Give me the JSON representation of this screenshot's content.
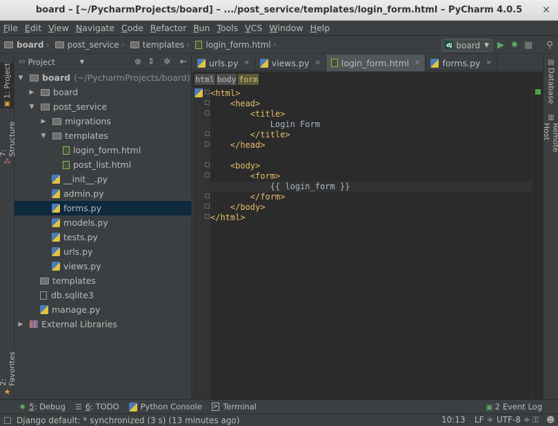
{
  "window": {
    "title": "board – [~/PycharmProjects/board] – .../post_service/templates/login_form.html – PyCharm 4.0.5"
  },
  "menu": [
    "File",
    "Edit",
    "View",
    "Navigate",
    "Code",
    "Refactor",
    "Run",
    "Tools",
    "VCS",
    "Window",
    "Help"
  ],
  "breadcrumbs": [
    "board",
    "post_service",
    "templates",
    "login_form.html"
  ],
  "run_config": {
    "badge": "dj",
    "name": "board"
  },
  "left_strip": {
    "project_tab": "1: Project",
    "structure_tab": "7: Structure",
    "favorites_tab": "2: Favorites"
  },
  "right_strip": {
    "database_tab": "Database",
    "remote_host_tab": "Remote Host"
  },
  "project_panel": {
    "view_label": "Project",
    "root": {
      "name": "board",
      "path": "(~/PycharmProjects/board)"
    },
    "items": [
      {
        "label": "board",
        "type": "folder",
        "expand": "collapsed"
      },
      {
        "label": "post_service",
        "type": "folder",
        "expand": "expanded"
      },
      {
        "label": "migrations",
        "type": "folder",
        "expand": "collapsed"
      },
      {
        "label": "templates",
        "type": "folder",
        "expand": "expanded"
      },
      {
        "label": "login_form.html",
        "type": "html"
      },
      {
        "label": "post_list.html",
        "type": "html"
      },
      {
        "label": "__init__.py",
        "type": "py"
      },
      {
        "label": "admin.py",
        "type": "py"
      },
      {
        "label": "forms.py",
        "type": "py",
        "selected": true
      },
      {
        "label": "models.py",
        "type": "py"
      },
      {
        "label": "tests.py",
        "type": "py"
      },
      {
        "label": "urls.py",
        "type": "py"
      },
      {
        "label": "views.py",
        "type": "py"
      },
      {
        "label": "templates",
        "type": "folder"
      },
      {
        "label": "db.sqlite3",
        "type": "db"
      },
      {
        "label": "manage.py",
        "type": "py"
      },
      {
        "label": "External Libraries",
        "type": "lib",
        "expand": "collapsed"
      }
    ]
  },
  "editor_tabs": [
    {
      "label": "urls.py",
      "type": "py",
      "active": false
    },
    {
      "label": "views.py",
      "type": "py",
      "active": false
    },
    {
      "label": "login_form.html",
      "type": "html",
      "active": true
    },
    {
      "label": "forms.py",
      "type": "py",
      "active": false
    }
  ],
  "editor_breadcrumbs": [
    "html",
    "body",
    "form"
  ],
  "code_lines": [
    "<html>",
    "    <head>",
    "        <title>",
    "            Login Form",
    "        </title>",
    "    </head>",
    "",
    "    <body>",
    "        <form>",
    "            {{ login_form }}",
    "        </form>",
    "    </body>",
    "</html>"
  ],
  "tool_windows": [
    {
      "number": "5",
      "label": ": Debug",
      "icon": "bug-icon"
    },
    {
      "number": "6",
      "label": ": TODO",
      "icon": "todo-icon"
    },
    {
      "number": "",
      "label": "Python Console",
      "icon": "python-icon"
    },
    {
      "number": "",
      "label": "Terminal",
      "icon": "terminal-icon"
    }
  ],
  "event_log": {
    "count": "2",
    "label": "Event Log"
  },
  "status_bar": {
    "message": "Django default: * synchronized (3 s) (13 minutes ago)",
    "position": "10:13",
    "line_sep": "LF ÷",
    "encoding": "UTF-8 ÷"
  },
  "colors": {
    "selection": "#0d293e",
    "tag": "#e8bf6a",
    "background": "#2b2b2b",
    "panel": "#3c3f41"
  }
}
